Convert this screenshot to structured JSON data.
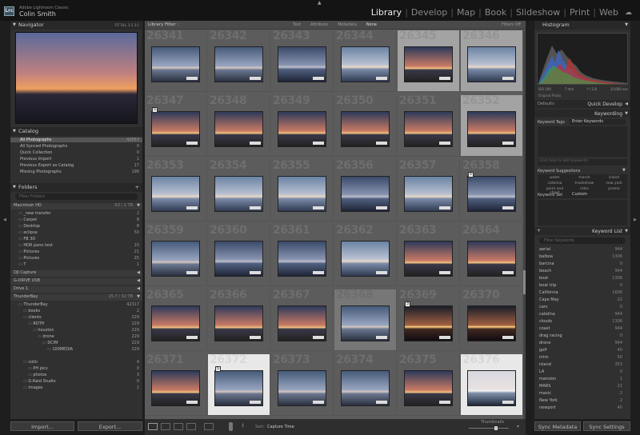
{
  "app": {
    "name": "Adobe Lightroom Classic",
    "user": "Colin Smith",
    "logo": "Lrc"
  },
  "modules": [
    "Library",
    "Develop",
    "Map",
    "Book",
    "Slideshow",
    "Print",
    "Web"
  ],
  "left": {
    "navigator": {
      "title": "Navigator",
      "zoom": [
        "FIT",
        "FILL",
        "1:1",
        "3:1"
      ]
    },
    "catalog": {
      "title": "Catalog",
      "items": [
        {
          "label": "All Photographs",
          "count": "42557"
        },
        {
          "label": "All Synced Photographs",
          "count": "0"
        },
        {
          "label": "Quick Collection",
          "count": "0"
        },
        {
          "label": "Previous Import",
          "count": "1"
        },
        {
          "label": "Previous Export as Catalog",
          "count": "17"
        },
        {
          "label": "Missing Photographs",
          "count": "196"
        }
      ]
    },
    "folders": {
      "title": "Folders",
      "search_placeholder": "Filter Folders",
      "volumes": [
        {
          "name": "Macintosh HD",
          "info": "63 / 1 TB"
        },
        {
          "name": "DJI Capture",
          "info": ""
        },
        {
          "name": "G-DRIVE USB",
          "info": ""
        },
        {
          "name": "Drive 1",
          "info": ""
        },
        {
          "name": "ThunderBay",
          "info": "15.7 / 32 TB"
        }
      ],
      "mac_items": [
        {
          "label": "_new transfer",
          "count": "2"
        },
        {
          "label": "Carpet",
          "count": "8"
        },
        {
          "label": "Desktop",
          "count": "8"
        },
        {
          "label": "eclipse",
          "count": "50"
        },
        {
          "label": "FB 3D",
          "count": ""
        },
        {
          "label": "HDR pano test",
          "count": "10"
        },
        {
          "label": "Pictures",
          "count": "21"
        },
        {
          "label": "Pictures",
          "count": "25"
        },
        {
          "label": "T",
          "count": "1"
        }
      ],
      "tb_items": [
        {
          "label": "ThunderBay",
          "count": "42317",
          "indent": 0
        },
        {
          "label": "books",
          "count": "2",
          "indent": 1
        },
        {
          "label": "clients",
          "count": "229",
          "indent": 1
        },
        {
          "label": "ROTH",
          "count": "229",
          "indent": 2
        },
        {
          "label": "houston",
          "count": "229",
          "indent": 3
        },
        {
          "label": "drone",
          "count": "229",
          "indent": 4
        },
        {
          "label": "DCIM",
          "count": "229",
          "indent": 5
        },
        {
          "label": "100MEDIA",
          "count": "229",
          "indent": 6
        },
        {
          "label": "",
          "count": "",
          "indent": 0
        },
        {
          "label": "colin",
          "count": "4",
          "indent": 1
        },
        {
          "label": "PH pics",
          "count": "0",
          "indent": 2
        },
        {
          "label": "photos",
          "count": "3",
          "indent": 2
        },
        {
          "label": "G-Raid Studio",
          "count": "0",
          "indent": 1
        },
        {
          "label": "images",
          "count": "1",
          "indent": 1
        }
      ]
    },
    "import_label": "Import...",
    "export_label": "Export..."
  },
  "center": {
    "filter": {
      "title": "Library Filter :",
      "options": [
        "Text",
        "Attribute",
        "Metadata",
        "None"
      ],
      "preset": "Filters Off"
    },
    "grid": [
      {
        "num": "26341",
        "state": "",
        "thumb": "t2",
        "flag": ""
      },
      {
        "num": "26342",
        "state": "",
        "thumb": "t2",
        "flag": ""
      },
      {
        "num": "26343",
        "state": "",
        "thumb": "t4",
        "flag": ""
      },
      {
        "num": "26344",
        "state": "",
        "thumb": "t3",
        "flag": ""
      },
      {
        "num": "26345",
        "state": "sel",
        "thumb": "",
        "flag": ""
      },
      {
        "num": "26346",
        "state": "sel",
        "thumb": "t3",
        "flag": ""
      },
      {
        "num": "26347",
        "state": "",
        "thumb": "",
        "flag": "5"
      },
      {
        "num": "26348",
        "state": "",
        "thumb": "",
        "flag": ""
      },
      {
        "num": "26349",
        "state": "",
        "thumb": "",
        "flag": ""
      },
      {
        "num": "26350",
        "state": "",
        "thumb": "",
        "flag": ""
      },
      {
        "num": "26351",
        "state": "",
        "thumb": "",
        "flag": ""
      },
      {
        "num": "26352",
        "state": "sel",
        "thumb": "",
        "flag": ""
      },
      {
        "num": "26353",
        "state": "",
        "thumb": "t3",
        "flag": ""
      },
      {
        "num": "26354",
        "state": "",
        "thumb": "t3",
        "flag": ""
      },
      {
        "num": "26355",
        "state": "",
        "thumb": "t3",
        "flag": ""
      },
      {
        "num": "26356",
        "state": "",
        "thumb": "t4",
        "flag": ""
      },
      {
        "num": "26357",
        "state": "",
        "thumb": "t3",
        "flag": ""
      },
      {
        "num": "26358",
        "state": "",
        "thumb": "t4",
        "flag": "5"
      },
      {
        "num": "26359",
        "state": "",
        "thumb": "t2",
        "flag": ""
      },
      {
        "num": "26360",
        "state": "",
        "thumb": "t4",
        "flag": ""
      },
      {
        "num": "26361",
        "state": "",
        "thumb": "t4",
        "flag": ""
      },
      {
        "num": "26362",
        "state": "",
        "thumb": "t3",
        "flag": ""
      },
      {
        "num": "26363",
        "state": "",
        "thumb": "",
        "flag": ""
      },
      {
        "num": "26364",
        "state": "",
        "thumb": "",
        "flag": ""
      },
      {
        "num": "26365",
        "state": "",
        "thumb": "",
        "flag": ""
      },
      {
        "num": "26366",
        "state": "",
        "thumb": "",
        "flag": ""
      },
      {
        "num": "26367",
        "state": "",
        "thumb": "",
        "flag": ""
      },
      {
        "num": "26368",
        "state": "dim",
        "thumb": "t2",
        "flag": ""
      },
      {
        "num": "26369",
        "state": "",
        "thumb": "t5",
        "flag": "3"
      },
      {
        "num": "26370",
        "state": "",
        "thumb": "t5",
        "flag": ""
      },
      {
        "num": "26371",
        "state": "",
        "thumb": "",
        "flag": ""
      },
      {
        "num": "26372",
        "state": "sel2",
        "thumb": "t2",
        "flag": "5"
      },
      {
        "num": "26373",
        "state": "",
        "thumb": "t2",
        "flag": ""
      },
      {
        "num": "26374",
        "state": "",
        "thumb": "t2",
        "flag": ""
      },
      {
        "num": "26375",
        "state": "",
        "thumb": "",
        "flag": ""
      },
      {
        "num": "26376",
        "state": "sel2",
        "thumb": "t6",
        "flag": ""
      }
    ],
    "toolbar": {
      "sort_label": "Sort:",
      "sort_value": "Capture Time",
      "thumbnails_label": "Thumbnails"
    }
  },
  "right": {
    "histogram": {
      "title": "Histogram",
      "readout": [
        "ISO 100",
        "7 mm",
        "f / 2.8",
        "1/1000 sec"
      ],
      "original": "Original Photo"
    },
    "quick_develop": {
      "title": "Quick Develop",
      "preset": "Defaults"
    },
    "keywording": {
      "title": "Keywording",
      "tags_label": "Keyword Tags",
      "tags_mode": "Enter Keywords",
      "click_placeholder": "Click here to add keywords",
      "suggestions_title": "Keyword Suggestions",
      "suggestions": [
        "water",
        "marsh",
        "island",
        "catalina",
        "tradeshow",
        "new york",
        "point and shoot",
        "retro",
        "promo"
      ],
      "set_label": "Keyword Set",
      "set_value": "Custom"
    },
    "keyword_list": {
      "title": "Keyword List",
      "filter_placeholder": "Filter Keywords",
      "items": [
        {
          "label": "aerial",
          "count": "944"
        },
        {
          "label": "balboa",
          "count": "1306"
        },
        {
          "label": "barcina",
          "count": "0"
        },
        {
          "label": "beach",
          "count": "944"
        },
        {
          "label": "boat",
          "count": "1306"
        },
        {
          "label": "boat trip",
          "count": "0"
        },
        {
          "label": "California",
          "count": "1606"
        },
        {
          "label": "Cape May",
          "count": "22"
        },
        {
          "label": "cars",
          "count": "0"
        },
        {
          "label": "catalina",
          "count": "944"
        },
        {
          "label": "clouds",
          "count": "1306"
        },
        {
          "label": "coast",
          "count": "944"
        },
        {
          "label": "drag racing",
          "count": "0"
        },
        {
          "label": "drone",
          "count": "944"
        },
        {
          "label": "golf",
          "count": "40"
        },
        {
          "label": "intro",
          "count": "50"
        },
        {
          "label": "island",
          "count": "353"
        },
        {
          "label": "LA",
          "count": "0"
        },
        {
          "label": "mansion",
          "count": "1"
        },
        {
          "label": "MARS",
          "count": "22"
        },
        {
          "label": "mavic",
          "count": "2"
        },
        {
          "label": "New York",
          "count": "2"
        },
        {
          "label": "newport",
          "count": "40"
        }
      ]
    },
    "sync_metadata_label": "Sync Metadata",
    "sync_settings_label": "Sync Settings"
  },
  "colors": {
    "accent": "#eeeeee",
    "panel": "#303030",
    "grid_bg": "#5c5c5c"
  }
}
